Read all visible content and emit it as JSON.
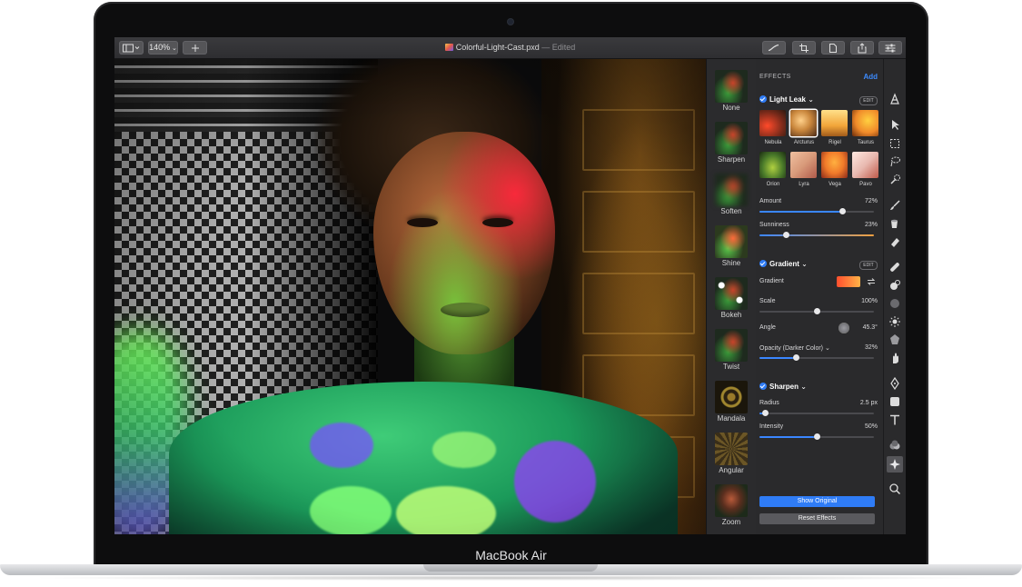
{
  "device": {
    "brand_label": "MacBook Air"
  },
  "toolbar": {
    "zoom_label": "140%",
    "document_title": "Colorful-Light-Cast.pxd",
    "document_status": "— Edited"
  },
  "thumbnails": [
    {
      "label": "None"
    },
    {
      "label": "Sharpen"
    },
    {
      "label": "Soften"
    },
    {
      "label": "Shine"
    },
    {
      "label": "Bokeh"
    },
    {
      "label": "Twist"
    },
    {
      "label": "Mandala"
    },
    {
      "label": "Angular"
    },
    {
      "label": "Zoom"
    }
  ],
  "effects": {
    "header": "EFFECTS",
    "add_label": "Add",
    "light_leak": {
      "title": "Light Leak",
      "edit_label": "EDIT",
      "presets": [
        {
          "label": "Nebula",
          "color": "#e05a2a"
        },
        {
          "label": "Arcturus",
          "color": "#c9863c"
        },
        {
          "label": "Rigel",
          "color": "#f2a53a"
        },
        {
          "label": "Taurus",
          "color": "#f08a2a"
        },
        {
          "label": "Orion",
          "color": "#6a9a3a"
        },
        {
          "label": "Lyra",
          "color": "#d89a7a"
        },
        {
          "label": "Vega",
          "color": "#f07a2a"
        },
        {
          "label": "Pavo",
          "color": "#e8b9b0"
        }
      ],
      "selected_preset": "Arcturus",
      "amount": {
        "label": "Amount",
        "value": "72%",
        "fraction": 0.72
      },
      "sunniness": {
        "label": "Sunniness",
        "value": "23%",
        "fraction": 0.23
      }
    },
    "gradient": {
      "title": "Gradient",
      "edit_label": "EDIT",
      "gradient_label": "Gradient",
      "scale": {
        "label": "Scale",
        "value": "100%",
        "fraction": 0.5
      },
      "angle": {
        "label": "Angle",
        "value": "45.3°"
      },
      "opacity": {
        "label": "Opacity (Darker Color)",
        "value": "32%",
        "fraction": 0.32
      }
    },
    "sharpen": {
      "title": "Sharpen",
      "radius": {
        "label": "Radius",
        "value": "2.5 px",
        "fraction": 0.05
      },
      "intensity": {
        "label": "Intensity",
        "value": "50%",
        "fraction": 0.5
      }
    },
    "show_original_label": "Show Original",
    "reset_effects_label": "Reset Effects"
  },
  "colors": {
    "accent": "#2f7cf6",
    "panel_bg": "#2a2a2c",
    "toolbar_bg": "#333336"
  },
  "tools": [
    "arrange-icon",
    "select-icon",
    "marquee-icon",
    "lasso-icon",
    "quick-select-icon",
    "paint-brush-icon",
    "paint-bucket-icon",
    "eraser-icon",
    "repair-icon",
    "clone-icon",
    "blur-icon",
    "light-icon",
    "color-icon",
    "smudge-icon",
    "pen-icon",
    "shape-icon",
    "text-icon",
    "color-adjust-icon",
    "effects-icon",
    "zoom-icon"
  ]
}
